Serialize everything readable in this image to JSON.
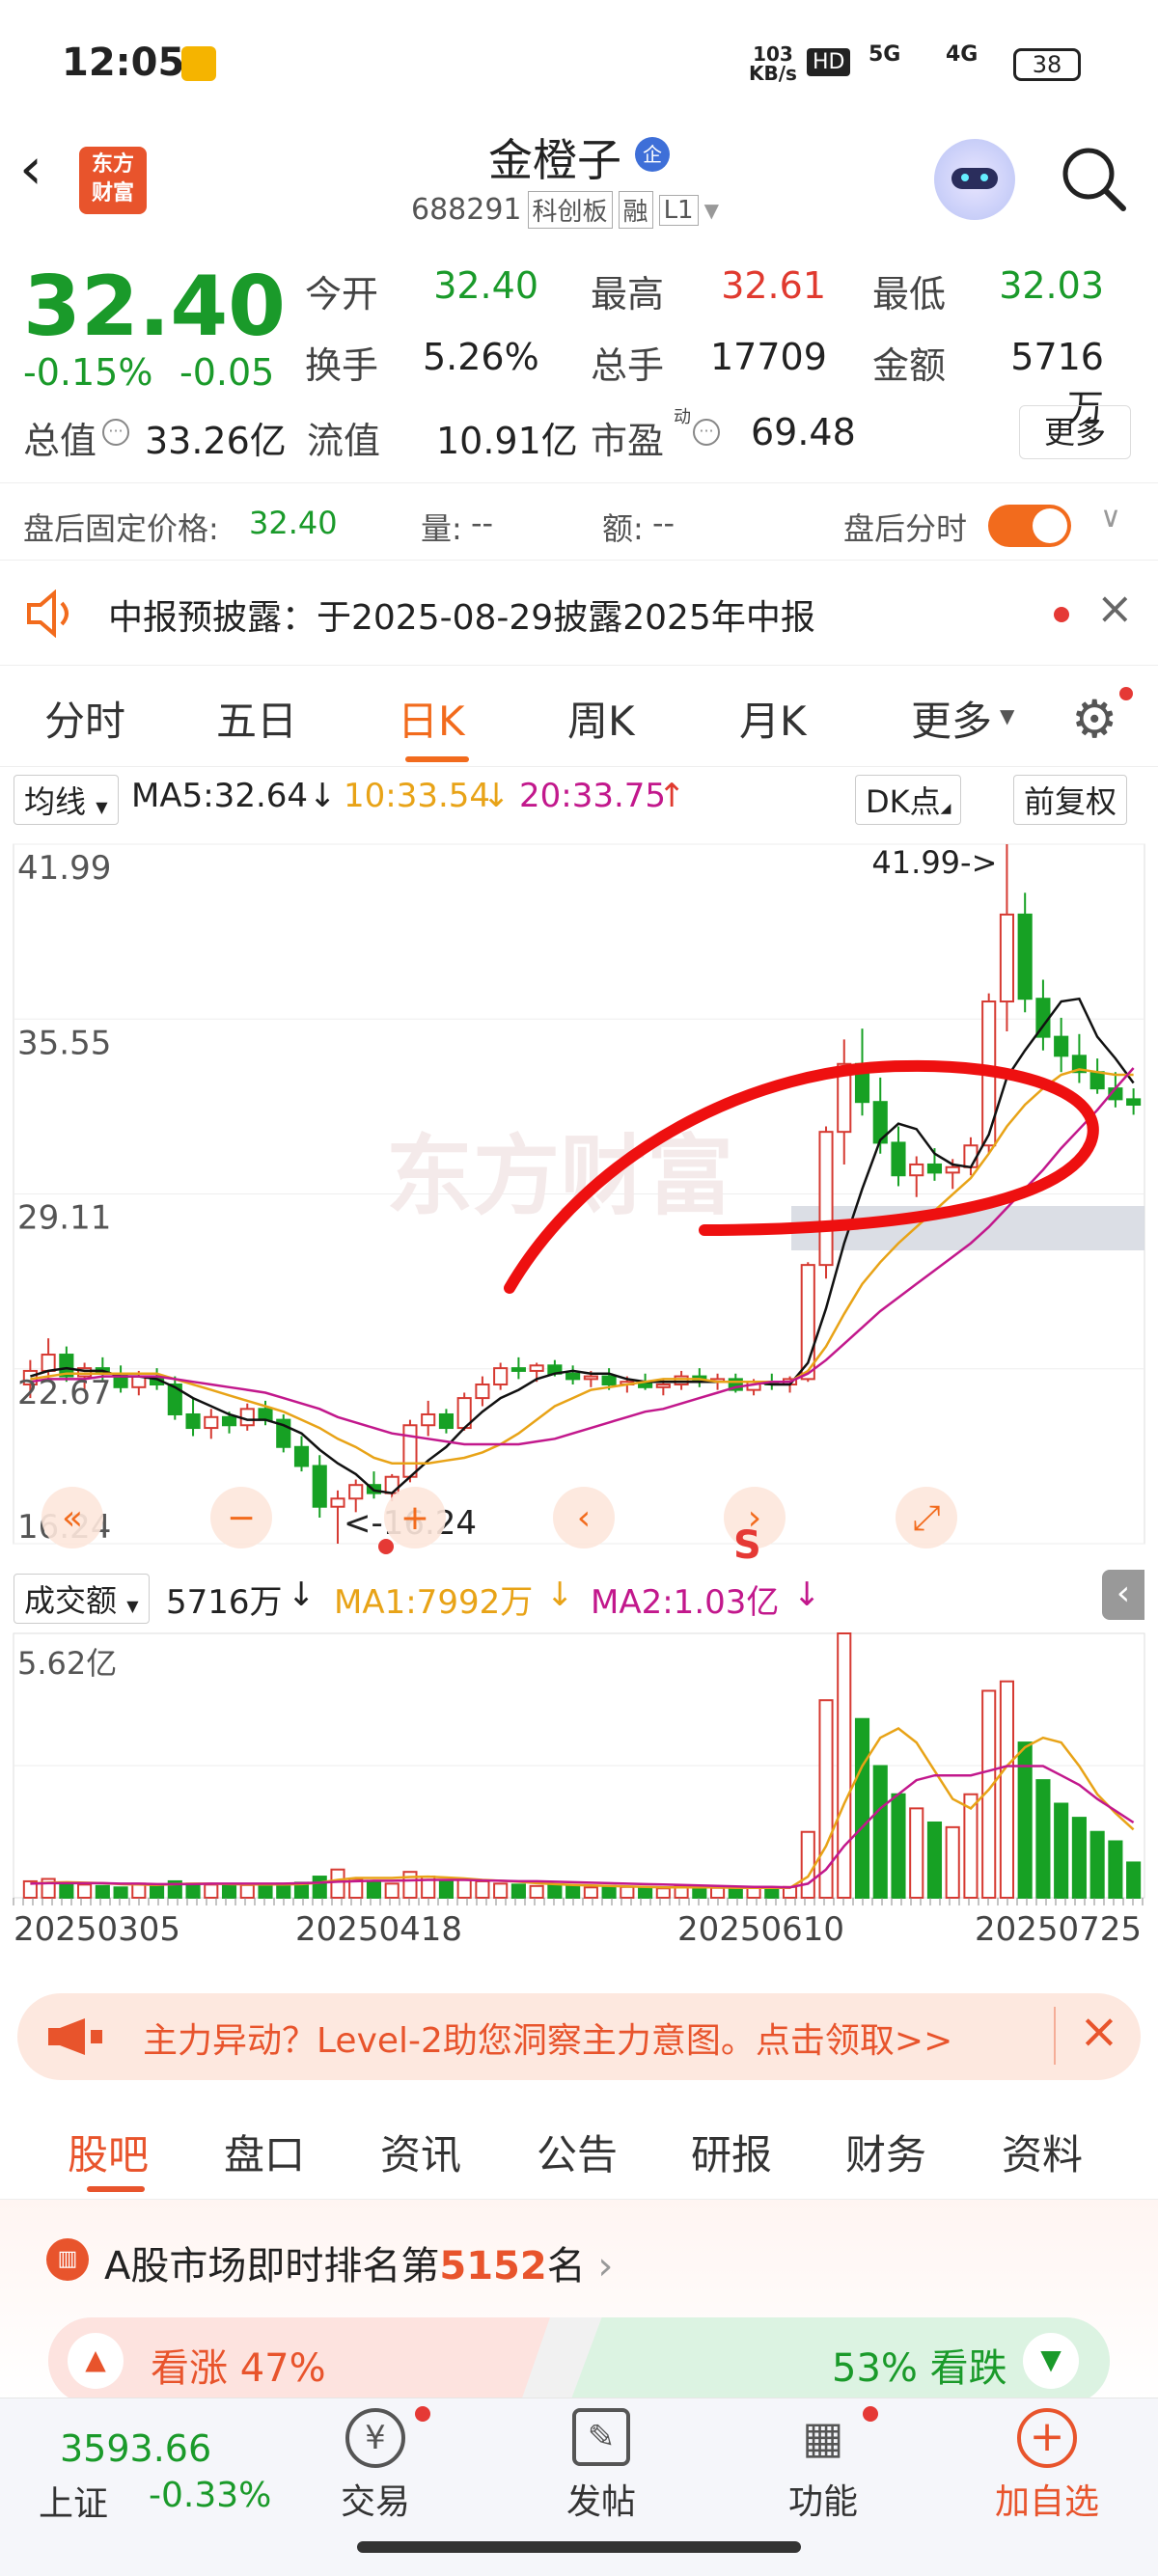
{
  "status": {
    "time": "12:05",
    "net_speed_top": "103",
    "net_speed_unit": "KB/s",
    "hd": "HD",
    "sig1": "5G",
    "sig2": "4G",
    "battery": "38"
  },
  "header": {
    "logo_line1": "东方",
    "logo_line2": "财富",
    "title": "金橙子",
    "badge": "企",
    "code": "688291",
    "tags": [
      "科创板",
      "融",
      "L1"
    ]
  },
  "quote": {
    "price": "32.40",
    "change_pct": "-0.15%",
    "change": "-0.05",
    "rows": [
      [
        {
          "l": "今开",
          "v": "32.40",
          "c": "green"
        },
        {
          "l": "最高",
          "v": "32.61",
          "c": "red"
        },
        {
          "l": "最低",
          "v": "32.03",
          "c": "green"
        }
      ],
      [
        {
          "l": "换手",
          "v": "5.26%",
          "c": "dark"
        },
        {
          "l": "总手",
          "v": "17709",
          "c": "dark"
        },
        {
          "l": "金额",
          "v": "5716万",
          "c": "dark"
        }
      ]
    ],
    "mktcap_label": "总值",
    "mktcap": "33.26亿",
    "float_label": "流值",
    "float": "10.91亿",
    "pe_label": "市盈",
    "pe_sup": "动",
    "pe": "69.48",
    "more": "更多",
    "after_label": "盘后固定价格:",
    "after_price": "32.40",
    "vol_label": "量:",
    "vol": "--",
    "amt_label": "额:",
    "amt": "--",
    "after_toggle": "盘后分时"
  },
  "notice": {
    "text": "中报预披露：于2025-08-29披露2025年中报"
  },
  "chart_tabs": [
    "分时",
    "五日",
    "日K",
    "周K",
    "月K",
    "更多"
  ],
  "active_tab": 2,
  "ma": {
    "select": "均线",
    "ma5": "MA5:32.64",
    "ma10": "10:33.54",
    "ma20": "20:33.75",
    "dk": "DK点",
    "adj": "前复权"
  },
  "vol_ind": {
    "select": "成交额",
    "v": "5716万",
    "ma1": "MA1:7992万",
    "ma2": "MA2:1.03亿"
  },
  "chart_data": {
    "type": "candlestick",
    "y_ticks": [
      "41.99",
      "35.55",
      "29.11",
      "22.67",
      "16.24"
    ],
    "ylim": [
      16.24,
      41.99
    ],
    "x_ticks": [
      "20250305",
      "20250418",
      "20250610",
      "20250725"
    ],
    "max_label": "41.99->",
    "min_label": "<-16.24",
    "vol_top_label": "5.62亿",
    "ohlc": [
      [
        22.1,
        23.0,
        21.6,
        22.6
      ],
      [
        22.6,
        23.8,
        22.3,
        23.2
      ],
      [
        23.2,
        23.5,
        22.2,
        22.4
      ],
      [
        22.4,
        22.9,
        21.9,
        22.7
      ],
      [
        22.7,
        23.1,
        22.2,
        22.5
      ],
      [
        22.5,
        22.8,
        21.8,
        22.0
      ],
      [
        22.0,
        22.6,
        21.7,
        22.4
      ],
      [
        22.4,
        22.7,
        21.9,
        22.1
      ],
      [
        22.1,
        22.4,
        20.8,
        21.0
      ],
      [
        21.0,
        21.6,
        20.2,
        20.5
      ],
      [
        20.5,
        21.2,
        20.1,
        20.9
      ],
      [
        20.9,
        21.1,
        20.3,
        20.6
      ],
      [
        20.6,
        21.4,
        20.4,
        21.2
      ],
      [
        21.2,
        21.5,
        20.6,
        20.8
      ],
      [
        20.8,
        21.0,
        19.6,
        19.8
      ],
      [
        19.8,
        20.2,
        18.9,
        19.1
      ],
      [
        19.1,
        19.5,
        17.2,
        17.6
      ],
      [
        17.6,
        18.2,
        16.24,
        17.9
      ],
      [
        17.9,
        18.6,
        17.4,
        18.4
      ],
      [
        18.4,
        18.9,
        17.9,
        18.1
      ],
      [
        18.1,
        18.8,
        17.8,
        18.7
      ],
      [
        18.7,
        20.8,
        18.5,
        20.6
      ],
      [
        20.6,
        21.5,
        20.2,
        21.0
      ],
      [
        21.0,
        21.2,
        20.3,
        20.5
      ],
      [
        20.5,
        21.8,
        20.4,
        21.6
      ],
      [
        21.6,
        22.4,
        21.3,
        22.1
      ],
      [
        22.1,
        22.9,
        21.9,
        22.7
      ],
      [
        22.7,
        23.1,
        22.3,
        22.6
      ],
      [
        22.6,
        22.9,
        22.2,
        22.8
      ],
      [
        22.8,
        23.0,
        22.4,
        22.5
      ],
      [
        22.5,
        22.8,
        22.1,
        22.3
      ],
      [
        22.3,
        22.6,
        22.0,
        22.4
      ],
      [
        22.4,
        22.7,
        21.9,
        22.1
      ],
      [
        22.1,
        22.4,
        21.8,
        22.2
      ],
      [
        22.2,
        22.5,
        21.9,
        22.0
      ],
      [
        22.0,
        22.3,
        21.7,
        22.1
      ],
      [
        22.1,
        22.6,
        21.9,
        22.4
      ],
      [
        22.4,
        22.7,
        22.0,
        22.2
      ],
      [
        22.2,
        22.5,
        21.9,
        22.3
      ],
      [
        22.3,
        22.5,
        21.8,
        21.9
      ],
      [
        21.9,
        22.3,
        21.7,
        22.2
      ],
      [
        22.2,
        22.5,
        21.9,
        22.1
      ],
      [
        22.1,
        22.4,
        21.8,
        22.3
      ],
      [
        22.3,
        26.6,
        22.2,
        26.5
      ],
      [
        26.5,
        31.6,
        26.0,
        31.4
      ],
      [
        31.4,
        34.8,
        30.2,
        33.9
      ],
      [
        33.9,
        35.2,
        32.0,
        32.5
      ],
      [
        32.5,
        33.4,
        30.6,
        31.0
      ],
      [
        31.0,
        31.6,
        29.4,
        29.8
      ],
      [
        29.8,
        30.5,
        29.0,
        30.2
      ],
      [
        30.2,
        30.8,
        29.6,
        29.9
      ],
      [
        29.9,
        30.4,
        29.3,
        30.1
      ],
      [
        30.1,
        31.2,
        29.8,
        30.9
      ],
      [
        30.9,
        36.5,
        30.6,
        36.2
      ],
      [
        36.2,
        41.99,
        35.1,
        39.4
      ],
      [
        39.4,
        40.2,
        35.8,
        36.3
      ],
      [
        36.3,
        37.0,
        34.4,
        34.9
      ],
      [
        34.9,
        35.6,
        33.6,
        34.2
      ],
      [
        34.2,
        35.0,
        33.2,
        33.6
      ],
      [
        33.6,
        34.1,
        32.8,
        33.0
      ],
      [
        33.0,
        33.6,
        32.3,
        32.6
      ],
      [
        32.6,
        33.0,
        32.03,
        32.4
      ]
    ],
    "amount": [
      0.35,
      0.4,
      0.3,
      0.28,
      0.25,
      0.22,
      0.3,
      0.25,
      0.35,
      0.3,
      0.28,
      0.25,
      0.27,
      0.26,
      0.3,
      0.32,
      0.45,
      0.6,
      0.4,
      0.35,
      0.3,
      0.55,
      0.45,
      0.35,
      0.4,
      0.35,
      0.3,
      0.28,
      0.25,
      0.27,
      0.24,
      0.22,
      0.25,
      0.23,
      0.22,
      0.2,
      0.24,
      0.22,
      0.21,
      0.2,
      0.22,
      0.21,
      0.23,
      1.4,
      4.2,
      5.62,
      3.8,
      2.8,
      2.2,
      1.9,
      1.6,
      1.5,
      2.2,
      4.4,
      4.6,
      3.3,
      2.5,
      2.0,
      1.7,
      1.4,
      1.2,
      0.75
    ],
    "ma5": [
      22.4,
      22.6,
      22.7,
      22.6,
      22.6,
      22.4,
      22.4,
      22.3,
      22.0,
      21.6,
      21.3,
      21.0,
      20.8,
      20.8,
      20.6,
      20.3,
      19.7,
      19.2,
      18.8,
      18.2,
      18.1,
      18.7,
      19.3,
      19.8,
      20.5,
      21.1,
      21.6,
      21.9,
      22.3,
      22.5,
      22.6,
      22.5,
      22.5,
      22.3,
      22.2,
      22.2,
      22.2,
      22.2,
      22.2,
      22.2,
      22.2,
      22.1,
      22.1,
      22.9,
      24.9,
      27.3,
      29.3,
      31.1,
      31.7,
      31.5,
      30.6,
      30.2,
      30.1,
      31.3,
      33.4,
      34.4,
      35.3,
      36.2,
      36.3,
      34.9,
      34.1,
      33.2
    ],
    "ma10": [
      22.3,
      22.4,
      22.5,
      22.5,
      22.5,
      22.5,
      22.5,
      22.5,
      22.3,
      22.1,
      21.9,
      21.7,
      21.5,
      21.3,
      21.1,
      20.8,
      20.5,
      20.1,
      19.8,
      19.4,
      19.2,
      19.2,
      19.2,
      19.3,
      19.4,
      19.6,
      19.9,
      20.3,
      20.8,
      21.3,
      21.6,
      21.9,
      22.0,
      22.1,
      22.2,
      22.3,
      22.3,
      22.3,
      22.2,
      22.2,
      22.2,
      22.2,
      22.2,
      22.6,
      23.5,
      24.7,
      25.8,
      26.6,
      27.3,
      27.9,
      28.5,
      29.1,
      29.7,
      30.6,
      31.6,
      32.4,
      33.0,
      33.5,
      33.7,
      33.6,
      33.5,
      33.5
    ],
    "ma20": [
      22.2,
      22.3,
      22.3,
      22.3,
      22.4,
      22.4,
      22.4,
      22.4,
      22.3,
      22.2,
      22.1,
      22.0,
      21.9,
      21.8,
      21.6,
      21.4,
      21.2,
      20.9,
      20.7,
      20.5,
      20.3,
      20.2,
      20.1,
      20.0,
      19.9,
      19.9,
      19.9,
      19.9,
      20.0,
      20.1,
      20.3,
      20.5,
      20.7,
      20.9,
      21.1,
      21.2,
      21.4,
      21.6,
      21.8,
      22.0,
      22.1,
      22.2,
      22.2,
      22.5,
      23.0,
      23.6,
      24.2,
      24.8,
      25.3,
      25.8,
      26.3,
      26.8,
      27.3,
      27.9,
      28.6,
      29.3,
      30.0,
      30.8,
      31.5,
      32.2,
      33.0,
      33.75
    ],
    "vma1": [
      0.3,
      0.32,
      0.33,
      0.32,
      0.31,
      0.29,
      0.28,
      0.27,
      0.29,
      0.3,
      0.3,
      0.29,
      0.28,
      0.28,
      0.28,
      0.29,
      0.32,
      0.38,
      0.42,
      0.42,
      0.42,
      0.44,
      0.45,
      0.43,
      0.41,
      0.38,
      0.36,
      0.34,
      0.31,
      0.29,
      0.27,
      0.26,
      0.25,
      0.24,
      0.23,
      0.22,
      0.22,
      0.22,
      0.22,
      0.21,
      0.21,
      0.21,
      0.21,
      0.45,
      1.1,
      2.0,
      2.8,
      3.4,
      3.6,
      3.3,
      2.7,
      2.1,
      1.9,
      2.3,
      2.8,
      3.2,
      3.4,
      3.3,
      2.8,
      2.2,
      1.8,
      1.45
    ],
    "vma2": [
      0.3,
      0.31,
      0.31,
      0.31,
      0.31,
      0.3,
      0.3,
      0.29,
      0.29,
      0.29,
      0.3,
      0.3,
      0.3,
      0.3,
      0.3,
      0.31,
      0.32,
      0.34,
      0.35,
      0.36,
      0.36,
      0.37,
      0.38,
      0.38,
      0.38,
      0.37,
      0.36,
      0.35,
      0.35,
      0.34,
      0.33,
      0.32,
      0.31,
      0.3,
      0.29,
      0.28,
      0.27,
      0.26,
      0.25,
      0.24,
      0.23,
      0.23,
      0.22,
      0.3,
      0.6,
      1.1,
      1.5,
      1.9,
      2.2,
      2.5,
      2.6,
      2.6,
      2.6,
      2.7,
      2.8,
      2.8,
      2.8,
      2.6,
      2.4,
      2.1,
      1.85,
      1.6
    ]
  },
  "promo": {
    "text": "主力异动？Level-2助您洞察主力意图。点击领取>>"
  },
  "sections": [
    "股吧",
    "盘口",
    "资讯",
    "公告",
    "研报",
    "财务",
    "资料"
  ],
  "rank": {
    "prefix": "A股市场即时排名第",
    "num": "5152",
    "suffix": "名",
    "bull": "看涨 47%",
    "bear": "53% 看跌"
  },
  "bottom": {
    "idx_value": "3593.66",
    "idx_name": "上证",
    "idx_chg": "-0.33%",
    "trade": "交易",
    "post": "发帖",
    "func": "功能",
    "add": "加自选"
  }
}
